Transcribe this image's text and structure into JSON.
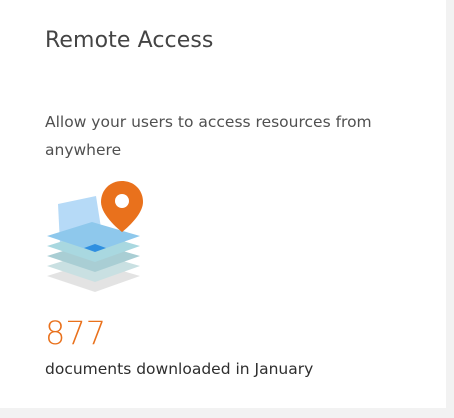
{
  "widget": {
    "title": "Remote Access",
    "description": "Allow your users to access resources from anywhere",
    "metric_value": "877",
    "metric_caption": "documents downloaded in January",
    "illustration_icon": "layered-map-location-pin-icon",
    "accent_color": "#e9711c"
  }
}
